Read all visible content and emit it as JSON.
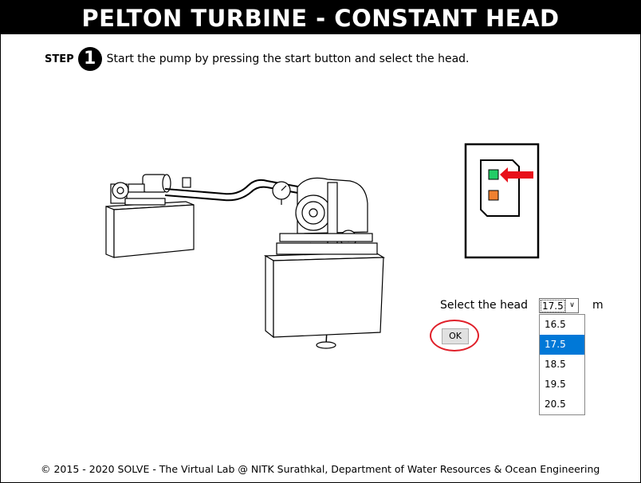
{
  "title": "PELTON TURBINE - CONSTANT HEAD",
  "step": {
    "label": "STEP",
    "number": "1",
    "instruction": "Start the pump by pressing the start button and select the head."
  },
  "control_panel": {
    "start_indicator_color": "#22cc66",
    "stop_indicator_color": "#f08030",
    "pointer_arrow_color": "#e8101a"
  },
  "head": {
    "label": "Select the head",
    "selected_value": "17.5",
    "unit": "m",
    "options": [
      "16.5",
      "17.5",
      "18.5",
      "19.5",
      "20.5"
    ],
    "highlight_color": "#0078d7"
  },
  "ok_button": {
    "label": "OK",
    "ring_color": "#e0202a"
  },
  "footer": "© 2015 - 2020 SOLVE - The Virtual Lab @ NITK Surathkal, Department of Water Resources & Ocean Engineering"
}
